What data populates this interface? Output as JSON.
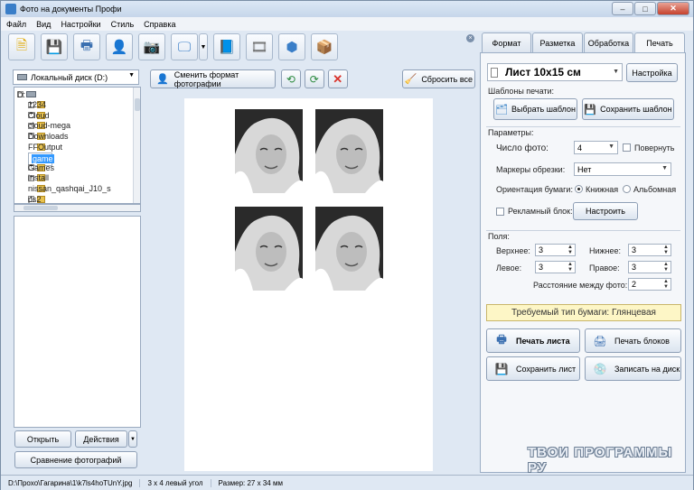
{
  "window": {
    "title": "Фото на документы Профи",
    "minimize": "–",
    "maximize": "□",
    "close": "✕"
  },
  "menu": [
    "Файл",
    "Вид",
    "Настройки",
    "Стиль",
    "Справка"
  ],
  "toolbar": {
    "icons": [
      "file-new-icon",
      "save-icon",
      "print-icon",
      "person-icon",
      "camera-icon",
      "monitor-icon",
      "book-icon",
      "film-icon",
      "cube-icon",
      "box-icon"
    ],
    "close": "×"
  },
  "left": {
    "drive": "Локальный диск (D:)",
    "tree": [
      {
        "label": "D:",
        "level": 0,
        "exp": "−",
        "kind": "drive"
      },
      {
        "label": "1234",
        "level": 1,
        "exp": "+"
      },
      {
        "label": "Cloud",
        "level": 1,
        "exp": "+"
      },
      {
        "label": "cloud-mega",
        "level": 1,
        "exp": "+"
      },
      {
        "label": "Downloads",
        "level": 1,
        "exp": "+"
      },
      {
        "label": "FFOutput",
        "level": 1,
        "exp": ""
      },
      {
        "label": "game",
        "level": 1,
        "exp": "+",
        "selected": true
      },
      {
        "label": "Games",
        "level": 1,
        "exp": "+"
      },
      {
        "label": "install",
        "level": 1,
        "exp": "+"
      },
      {
        "label": "nissan_qashqai_J10_s",
        "level": 1,
        "exp": ""
      },
      {
        "label": "ps2",
        "level": 1,
        "exp": "+"
      }
    ],
    "open_button": "Открыть",
    "actions_button": "Действия",
    "compare_button": "Сравнение фотографий"
  },
  "center": {
    "change_format": "Сменить формат фотографии",
    "reset": "Сбросить все"
  },
  "right": {
    "tabs": [
      "Формат",
      "Разметка",
      "Обработка",
      "Печать"
    ],
    "active_tab": "Печать",
    "sheet": "Лист 10x15 см",
    "settings_btn": "Настройка",
    "templates_label": "Шаблоны печати:",
    "choose_template": "Выбрать шаблон",
    "save_template": "Сохранить шаблон",
    "params_label": "Параметры:",
    "count_label": "Число фото:",
    "count_value": "4",
    "rotate_label": "Повернуть",
    "markers_label": "Маркеры обрезки:",
    "markers_value": "Нет",
    "orient_label": "Ориентация бумаги:",
    "portrait": "Книжная",
    "landscape": "Альбомная",
    "ad_label": "Рекламный блок:",
    "configure_btn": "Настроить",
    "fields_label": "Поля:",
    "top_label": "Верхнее:",
    "top_value": "3",
    "bottom_label": "Нижнее:",
    "bottom_value": "3",
    "left_label": "Левое:",
    "left_value": "3",
    "right_label": "Правое:",
    "right_value": "3",
    "gap_label": "Расстояние между фото:",
    "gap_value": "2",
    "paper_notice": "Требуемый тип бумаги: Глянцевая",
    "print_sheet": "Печать листа",
    "print_blocks": "Печать блоков",
    "save_sheet": "Сохранить лист",
    "write_disk": "Записать на диск"
  },
  "watermark": "ТВОИ ПРОГРАММЫ РУ",
  "status": {
    "path": "D:\\Прохо\\Гагарина\\1\\k7ls4hoTUnY.jpg",
    "layout": "3 x 4 левый угол",
    "size": "Размер: 27 x 34 мм"
  }
}
